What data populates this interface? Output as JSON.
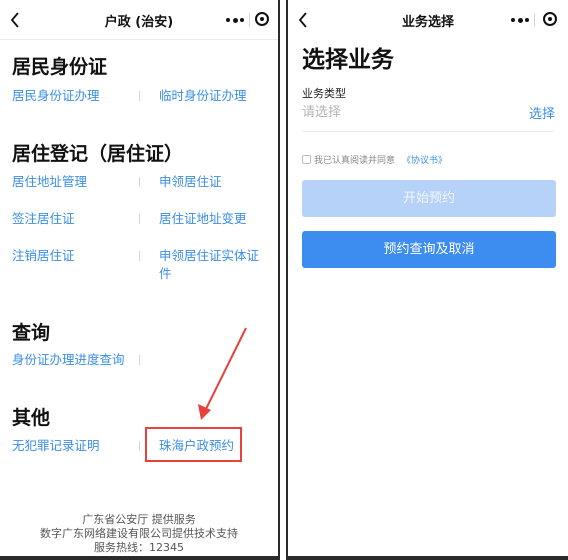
{
  "left": {
    "nav": {
      "back_icon": "chevron-left-icon",
      "title": "户政 (治安)",
      "more_icon": "more-dots-icon",
      "close_icon": "close-target-icon"
    },
    "sections": [
      {
        "title": "居民身份证",
        "items": [
          "居民身份证办理",
          "临时身份证办理"
        ]
      },
      {
        "title": "居住登记（居住证）",
        "items": [
          "居住地址管理",
          "申领居住证",
          "签注居住证",
          "居住证地址变更",
          "注销居住证",
          "申领居住证实体证件"
        ]
      },
      {
        "title": "查询",
        "items": [
          "身份证办理进度查询"
        ]
      },
      {
        "title": "其他",
        "items": [
          "无犯罪记录证明",
          "珠海户政预约"
        ]
      }
    ],
    "annotation_color": "#e8403a",
    "footer": {
      "line1": "广东省公安厅 提供服务",
      "line2": "数字广东网络建设有限公司提供技术支持",
      "line3": "服务热线：12345"
    }
  },
  "right": {
    "nav": {
      "back_icon": "chevron-left-icon",
      "title": "业务选择",
      "more_icon": "more-dots-icon",
      "close_icon": "close-target-icon"
    },
    "page_title": "选择业务",
    "field": {
      "label": "业务类型",
      "placeholder": "请选择",
      "value": "",
      "action": "选择"
    },
    "agreement": {
      "text": "我已认真阅读并同意",
      "link": "《协议书》",
      "checked": false
    },
    "buttons": {
      "start": "开始预约",
      "query": "预约查询及取消"
    }
  },
  "colors": {
    "link": "#3a8ee6",
    "primary": "#3d8cf0",
    "disabled": "#b7d2f8",
    "annotation": "#e8403a"
  }
}
